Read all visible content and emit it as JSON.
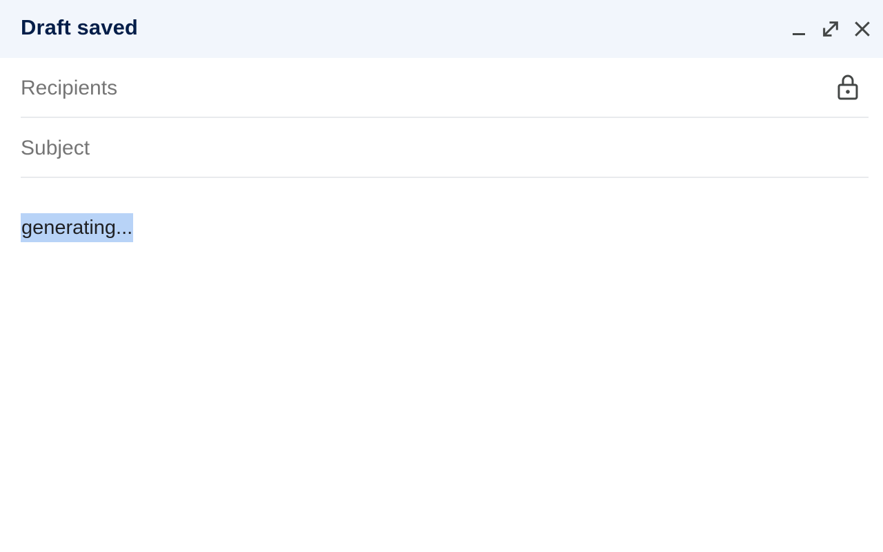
{
  "header": {
    "title": "Draft saved",
    "icons": {
      "minimize": "minimize-icon",
      "expand": "expand-icon",
      "close": "close-icon"
    }
  },
  "fields": {
    "recipients": {
      "placeholder": "Recipients",
      "value": "",
      "icon": "lock-icon"
    },
    "subject": {
      "placeholder": "Subject",
      "value": ""
    }
  },
  "body": {
    "text": "generating...",
    "selected": true
  },
  "colors": {
    "header_background": "#f2f6fc",
    "title_text": "#041e49",
    "placeholder_text": "#757575",
    "selection_highlight": "#b8d3f7",
    "divider": "#e8eaed",
    "icon": "#444746"
  }
}
